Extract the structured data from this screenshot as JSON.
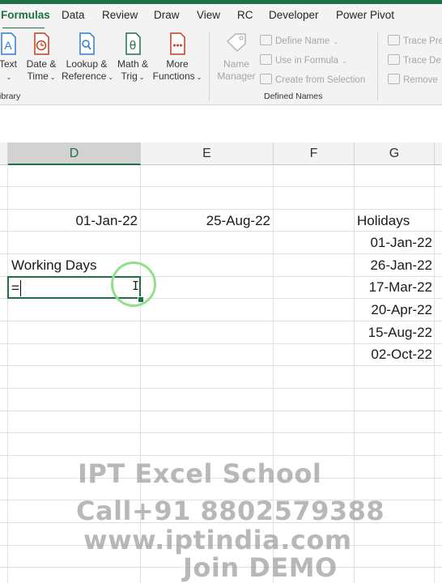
{
  "ribbon_tabs": [
    {
      "label": "Formulas",
      "active": true
    },
    {
      "label": "Data"
    },
    {
      "label": "Review"
    },
    {
      "label": "Draw"
    },
    {
      "label": "View"
    },
    {
      "label": "RC"
    },
    {
      "label": "Developer"
    },
    {
      "label": "Power Pivot"
    }
  ],
  "library_group": {
    "label": "ibrary",
    "buttons": [
      {
        "line1": "Text",
        "line2": "",
        "icon": "text-icon"
      },
      {
        "line1": "Date &",
        "line2": "Time",
        "icon": "clock-icon"
      },
      {
        "line1": "Lookup &",
        "line2": "Reference",
        "icon": "search-book-icon"
      },
      {
        "line1": "Math &",
        "line2": "Trig",
        "icon": "theta-icon"
      },
      {
        "line1": "More",
        "line2": "Functions",
        "icon": "more-functions-icon"
      }
    ]
  },
  "defined_names_group": {
    "label": "Defined Names",
    "name_manager": {
      "line1": "Name",
      "line2": "Manager"
    },
    "define_name": "Define Name",
    "use_in_formula": "Use in Formula",
    "create_from_selection": "Create from Selection"
  },
  "auditing_group": {
    "trace_precedents": "Trace Pre",
    "trace_dependents": "Trace De",
    "remove_arrows": "Remove"
  },
  "columns": [
    "D",
    "E",
    "F",
    "G"
  ],
  "selected_column": "D",
  "cells": {
    "d_date": "01-Jan-22",
    "e_date": "25-Aug-22",
    "holidays_header": "Holidays",
    "working_days_label": "Working Days",
    "active_cell_value": "=",
    "holidays": [
      "01-Jan-22",
      "26-Jan-22",
      "17-Mar-22",
      "20-Apr-22",
      "15-Aug-22",
      "02-Oct-22"
    ]
  },
  "watermark": {
    "line1": "IPT Excel School",
    "line2": "Call+91 8802579388",
    "line3": "www.iptindia.com",
    "line4": "Join DEMO"
  },
  "colors": {
    "accent": "#1e7145",
    "cursor_ring": "#90e08a"
  }
}
